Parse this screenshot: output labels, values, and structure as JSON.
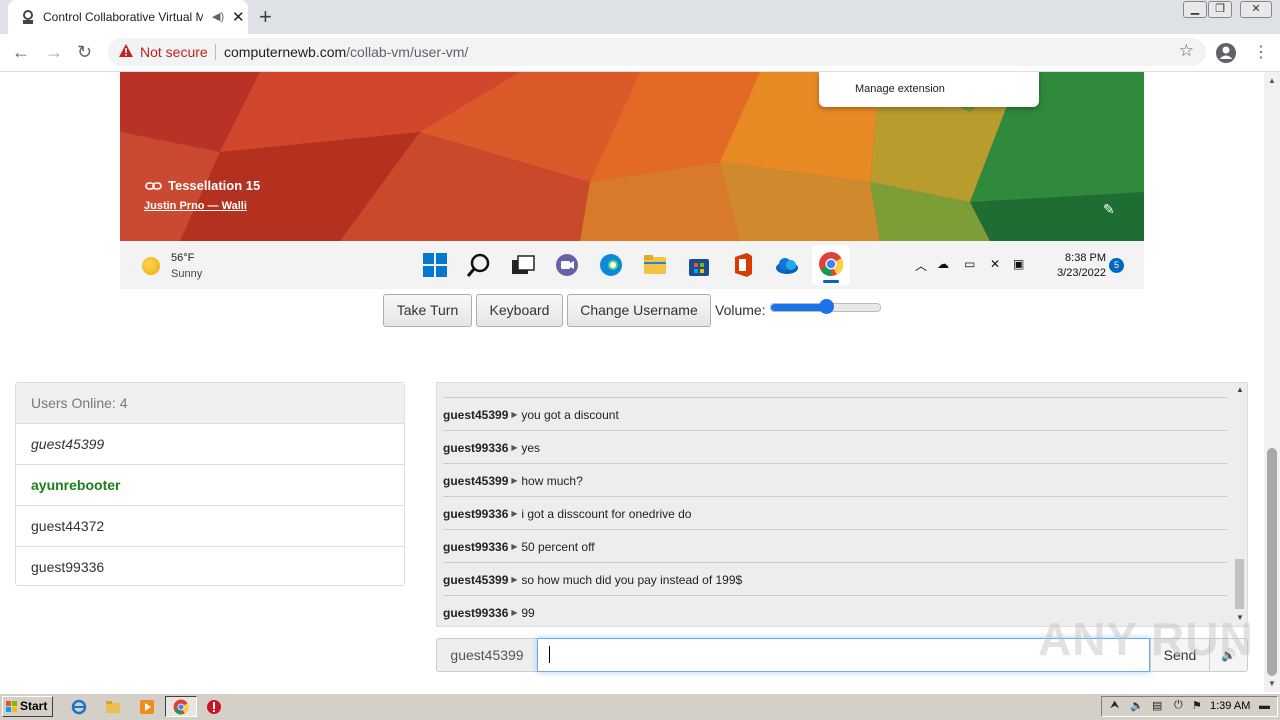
{
  "browser": {
    "tab_title": "Control Collaborative Virtual Ma",
    "security_label": "Not secure",
    "url_host": "computernewb.com",
    "url_path": "/collab-vm/user-vm/"
  },
  "vm_screen": {
    "extension_menu_item": "Manage extension",
    "wallpaper_title": "Tessellation 15",
    "wallpaper_author": "Justin Prno — Walli",
    "weather_temp": "56°F",
    "weather_condition": "Sunny",
    "clock_time": "8:38 PM",
    "clock_date": "3/23/2022",
    "notification_count": "5"
  },
  "controls": {
    "take_turn": "Take Turn",
    "keyboard": "Keyboard",
    "change_username": "Change Username",
    "volume_label": "Volume:",
    "volume_level": 0.5
  },
  "users_panel": {
    "header": "Users Online: 4",
    "users": [
      {
        "name": "guest45399",
        "style": "italic"
      },
      {
        "name": "ayunrebooter",
        "style": "admin",
        "color": "#1a7f1a"
      },
      {
        "name": "guest44372",
        "style": "normal"
      },
      {
        "name": "guest99336",
        "style": "normal"
      }
    ]
  },
  "chat": {
    "messages": [
      {
        "user": "guest45399",
        "text": "you got a discount"
      },
      {
        "user": "guest99336",
        "text": "yes"
      },
      {
        "user": "guest45399",
        "text": "how much?"
      },
      {
        "user": "guest99336",
        "text": "i got a disscount for onedrive do"
      },
      {
        "user": "guest99336",
        "text": "50 percent off"
      },
      {
        "user": "guest45399",
        "text": "so how much did you pay instead of 199$"
      },
      {
        "user": "guest99336",
        "text": "99"
      }
    ],
    "current_username": "guest45399",
    "input_value": "",
    "send_label": "Send"
  },
  "watermark": "ANY RUN",
  "host_taskbar": {
    "start_label": "Start",
    "clock": "1:39 AM"
  },
  "colors": {
    "accent": "#1a73e8",
    "not_secure": "#c5221f",
    "admin_user": "#1a7f1a"
  }
}
